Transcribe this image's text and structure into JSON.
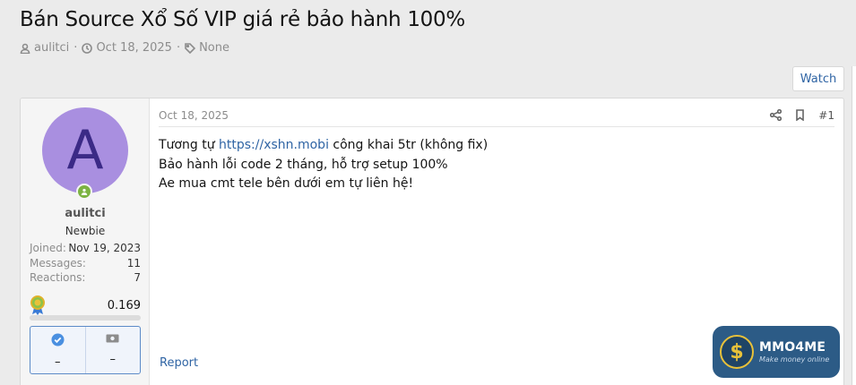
{
  "thread": {
    "title": "Bán Source Xổ Số VIP giá rẻ bảo hành 100%",
    "author": "aulitci",
    "date": "Oct 18, 2025",
    "tags": "None",
    "sep": "·"
  },
  "watch_label": "Watch",
  "user": {
    "avatar_letter": "A",
    "name": "aulitci",
    "title": "Newbie",
    "stats": [
      {
        "label": "Joined:",
        "value": "Nov 19, 2023"
      },
      {
        "label": "Messages:",
        "value": "11"
      },
      {
        "label": "Reactions:",
        "value": "7"
      }
    ],
    "points": "0.169",
    "points_progress": 0,
    "badges": [
      "–",
      "–"
    ]
  },
  "post": {
    "date": "Oct 18, 2025",
    "number": "#1",
    "line1_pre": "Tương tự ",
    "line1_link": "https://xshn.mobi",
    "line1_post": " công khai 5tr (không fix)",
    "line2": "Bảo hành lỗi code 2 tháng, hỗ trợ setup 100%",
    "line3": "Ae mua cmt tele bên dưới em tự liên hệ!",
    "report_label": "Report"
  },
  "watermark": {
    "brand": "MMO4ME",
    "tagline": "Make money online",
    "symbol": "$"
  },
  "colors": {
    "link": "#2f64a4",
    "avatar_bg": "#a98fe0",
    "online": "#7cb342"
  }
}
